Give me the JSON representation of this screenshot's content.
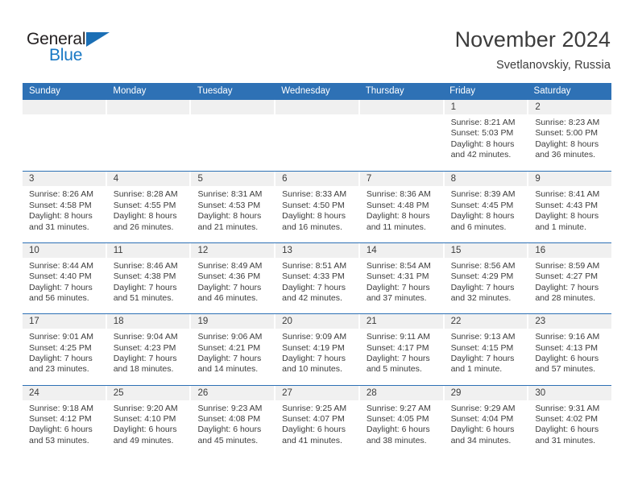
{
  "brand": {
    "word_one": "General",
    "word_two": "Blue",
    "mark": "triangle-logo"
  },
  "header": {
    "title": "November 2024",
    "subtitle": "Svetlanovskiy, Russia"
  },
  "theme": {
    "accent": "#2E71B5",
    "day_strip": "#F0F0F0",
    "text": "#3C3C3C",
    "brand_blue": "#1878C4"
  },
  "weekdays": [
    "Sunday",
    "Monday",
    "Tuesday",
    "Wednesday",
    "Thursday",
    "Friday",
    "Saturday"
  ],
  "weeks": [
    [
      {
        "empty": true
      },
      {
        "empty": true
      },
      {
        "empty": true
      },
      {
        "empty": true
      },
      {
        "empty": true
      },
      {
        "day": "1",
        "sunrise": "Sunrise: 8:21 AM",
        "sunset": "Sunset: 5:03 PM",
        "daylight1": "Daylight: 8 hours",
        "daylight2": "and 42 minutes."
      },
      {
        "day": "2",
        "sunrise": "Sunrise: 8:23 AM",
        "sunset": "Sunset: 5:00 PM",
        "daylight1": "Daylight: 8 hours",
        "daylight2": "and 36 minutes."
      }
    ],
    [
      {
        "day": "3",
        "sunrise": "Sunrise: 8:26 AM",
        "sunset": "Sunset: 4:58 PM",
        "daylight1": "Daylight: 8 hours",
        "daylight2": "and 31 minutes."
      },
      {
        "day": "4",
        "sunrise": "Sunrise: 8:28 AM",
        "sunset": "Sunset: 4:55 PM",
        "daylight1": "Daylight: 8 hours",
        "daylight2": "and 26 minutes."
      },
      {
        "day": "5",
        "sunrise": "Sunrise: 8:31 AM",
        "sunset": "Sunset: 4:53 PM",
        "daylight1": "Daylight: 8 hours",
        "daylight2": "and 21 minutes."
      },
      {
        "day": "6",
        "sunrise": "Sunrise: 8:33 AM",
        "sunset": "Sunset: 4:50 PM",
        "daylight1": "Daylight: 8 hours",
        "daylight2": "and 16 minutes."
      },
      {
        "day": "7",
        "sunrise": "Sunrise: 8:36 AM",
        "sunset": "Sunset: 4:48 PM",
        "daylight1": "Daylight: 8 hours",
        "daylight2": "and 11 minutes."
      },
      {
        "day": "8",
        "sunrise": "Sunrise: 8:39 AM",
        "sunset": "Sunset: 4:45 PM",
        "daylight1": "Daylight: 8 hours",
        "daylight2": "and 6 minutes."
      },
      {
        "day": "9",
        "sunrise": "Sunrise: 8:41 AM",
        "sunset": "Sunset: 4:43 PM",
        "daylight1": "Daylight: 8 hours",
        "daylight2": "and 1 minute."
      }
    ],
    [
      {
        "day": "10",
        "sunrise": "Sunrise: 8:44 AM",
        "sunset": "Sunset: 4:40 PM",
        "daylight1": "Daylight: 7 hours",
        "daylight2": "and 56 minutes."
      },
      {
        "day": "11",
        "sunrise": "Sunrise: 8:46 AM",
        "sunset": "Sunset: 4:38 PM",
        "daylight1": "Daylight: 7 hours",
        "daylight2": "and 51 minutes."
      },
      {
        "day": "12",
        "sunrise": "Sunrise: 8:49 AM",
        "sunset": "Sunset: 4:36 PM",
        "daylight1": "Daylight: 7 hours",
        "daylight2": "and 46 minutes."
      },
      {
        "day": "13",
        "sunrise": "Sunrise: 8:51 AM",
        "sunset": "Sunset: 4:33 PM",
        "daylight1": "Daylight: 7 hours",
        "daylight2": "and 42 minutes."
      },
      {
        "day": "14",
        "sunrise": "Sunrise: 8:54 AM",
        "sunset": "Sunset: 4:31 PM",
        "daylight1": "Daylight: 7 hours",
        "daylight2": "and 37 minutes."
      },
      {
        "day": "15",
        "sunrise": "Sunrise: 8:56 AM",
        "sunset": "Sunset: 4:29 PM",
        "daylight1": "Daylight: 7 hours",
        "daylight2": "and 32 minutes."
      },
      {
        "day": "16",
        "sunrise": "Sunrise: 8:59 AM",
        "sunset": "Sunset: 4:27 PM",
        "daylight1": "Daylight: 7 hours",
        "daylight2": "and 28 minutes."
      }
    ],
    [
      {
        "day": "17",
        "sunrise": "Sunrise: 9:01 AM",
        "sunset": "Sunset: 4:25 PM",
        "daylight1": "Daylight: 7 hours",
        "daylight2": "and 23 minutes."
      },
      {
        "day": "18",
        "sunrise": "Sunrise: 9:04 AM",
        "sunset": "Sunset: 4:23 PM",
        "daylight1": "Daylight: 7 hours",
        "daylight2": "and 18 minutes."
      },
      {
        "day": "19",
        "sunrise": "Sunrise: 9:06 AM",
        "sunset": "Sunset: 4:21 PM",
        "daylight1": "Daylight: 7 hours",
        "daylight2": "and 14 minutes."
      },
      {
        "day": "20",
        "sunrise": "Sunrise: 9:09 AM",
        "sunset": "Sunset: 4:19 PM",
        "daylight1": "Daylight: 7 hours",
        "daylight2": "and 10 minutes."
      },
      {
        "day": "21",
        "sunrise": "Sunrise: 9:11 AM",
        "sunset": "Sunset: 4:17 PM",
        "daylight1": "Daylight: 7 hours",
        "daylight2": "and 5 minutes."
      },
      {
        "day": "22",
        "sunrise": "Sunrise: 9:13 AM",
        "sunset": "Sunset: 4:15 PM",
        "daylight1": "Daylight: 7 hours",
        "daylight2": "and 1 minute."
      },
      {
        "day": "23",
        "sunrise": "Sunrise: 9:16 AM",
        "sunset": "Sunset: 4:13 PM",
        "daylight1": "Daylight: 6 hours",
        "daylight2": "and 57 minutes."
      }
    ],
    [
      {
        "day": "24",
        "sunrise": "Sunrise: 9:18 AM",
        "sunset": "Sunset: 4:12 PM",
        "daylight1": "Daylight: 6 hours",
        "daylight2": "and 53 minutes."
      },
      {
        "day": "25",
        "sunrise": "Sunrise: 9:20 AM",
        "sunset": "Sunset: 4:10 PM",
        "daylight1": "Daylight: 6 hours",
        "daylight2": "and 49 minutes."
      },
      {
        "day": "26",
        "sunrise": "Sunrise: 9:23 AM",
        "sunset": "Sunset: 4:08 PM",
        "daylight1": "Daylight: 6 hours",
        "daylight2": "and 45 minutes."
      },
      {
        "day": "27",
        "sunrise": "Sunrise: 9:25 AM",
        "sunset": "Sunset: 4:07 PM",
        "daylight1": "Daylight: 6 hours",
        "daylight2": "and 41 minutes."
      },
      {
        "day": "28",
        "sunrise": "Sunrise: 9:27 AM",
        "sunset": "Sunset: 4:05 PM",
        "daylight1": "Daylight: 6 hours",
        "daylight2": "and 38 minutes."
      },
      {
        "day": "29",
        "sunrise": "Sunrise: 9:29 AM",
        "sunset": "Sunset: 4:04 PM",
        "daylight1": "Daylight: 6 hours",
        "daylight2": "and 34 minutes."
      },
      {
        "day": "30",
        "sunrise": "Sunrise: 9:31 AM",
        "sunset": "Sunset: 4:02 PM",
        "daylight1": "Daylight: 6 hours",
        "daylight2": "and 31 minutes."
      }
    ]
  ]
}
